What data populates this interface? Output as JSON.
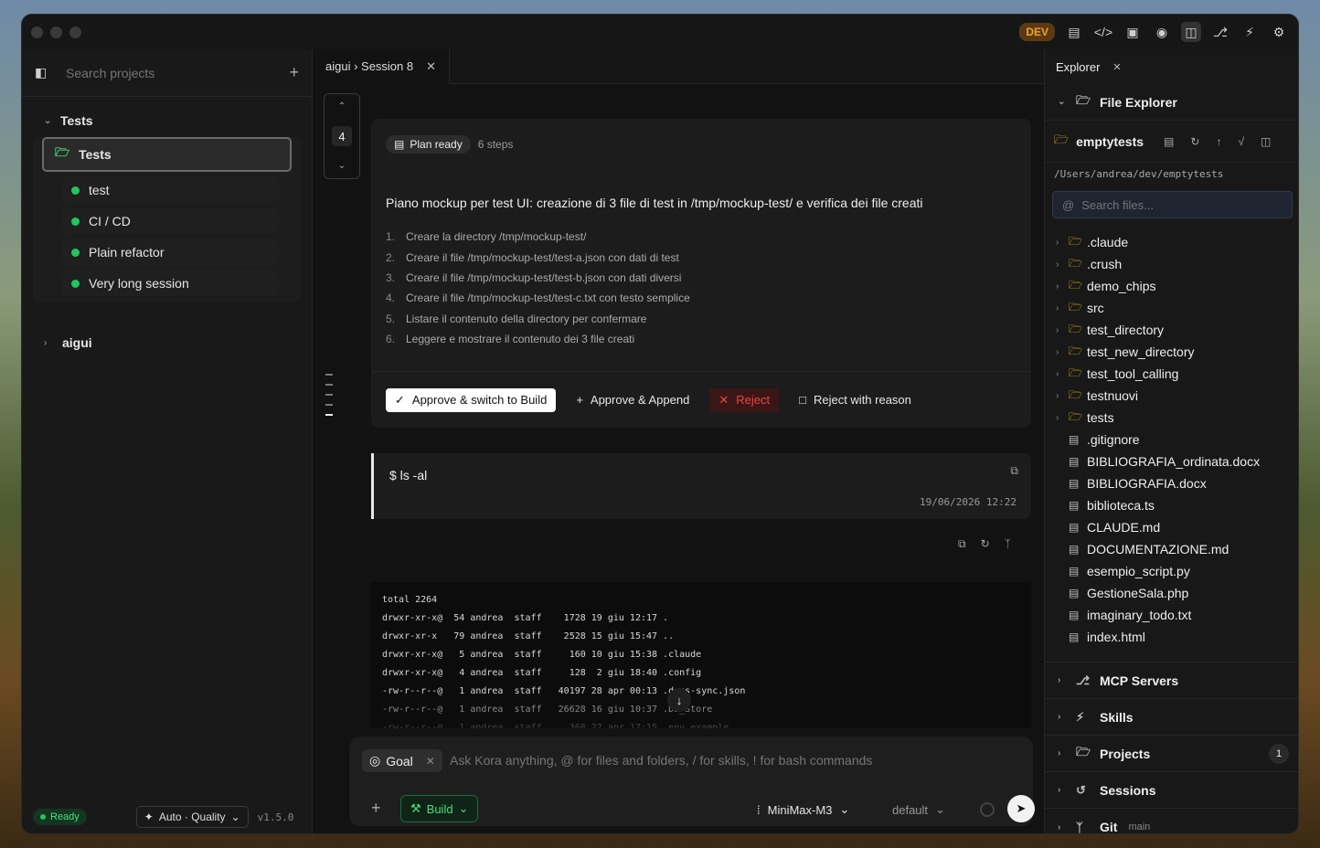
{
  "titlebar": {
    "dev_badge": "DEV",
    "icons": [
      "file-tree-icon",
      "code-icon",
      "terminal-icon",
      "palette-icon",
      "panel-icon",
      "plug-icon",
      "bolt-icon",
      "settings-icon"
    ]
  },
  "sidebar": {
    "search_placeholder": "Search projects",
    "groups": [
      {
        "name": "Tests",
        "folder": "Tests",
        "sessions": [
          "test",
          "CI / CD",
          "Plain refactor",
          "Very long session"
        ]
      },
      {
        "name": "aigui"
      }
    ],
    "status": "Ready",
    "mode": "Auto · Quality",
    "version": "v1.5.0"
  },
  "center": {
    "tab": {
      "label": "aigui › Session 8"
    },
    "stepper": {
      "value": "4"
    },
    "plan": {
      "badge": "Plan ready",
      "steps": "6 steps",
      "title": "Piano mockup per test UI: creazione di 3 file di test in /tmp/mockup-test/ e verifica dei file creati",
      "items": [
        "Creare la directory /tmp/mockup-test/",
        "Creare il file /tmp/mockup-test/test-a.json con dati di test",
        "Creare il file /tmp/mockup-test/test-b.json con dati diversi",
        "Creare il file /tmp/mockup-test/test-c.txt con testo semplice",
        "Listare il contenuto della directory per confermare",
        "Leggere e mostrare il contenuto dei 3 file creati"
      ],
      "actions": {
        "approve_build": "Approve & switch to Build",
        "approve_append": "Approve & Append",
        "reject": "Reject",
        "reject_reason": "Reject with reason"
      }
    },
    "command": {
      "text": "$ ls -al",
      "time": "19/06/2026 12:22"
    },
    "terminal": [
      "total 2264",
      "drwxr-xr-x@  54 andrea  staff    1728 19 giu 12:17 .",
      "drwxr-xr-x   79 andrea  staff    2528 15 giu 15:47 ..",
      "drwxr-xr-x@   5 andrea  staff     160 10 giu 15:38 .claude",
      "drwxr-xr-x@   4 andrea  staff     128  2 giu 18:40 .config",
      "-rw-r--r--@   1 andrea  staff   40197 28 apr 00:13 .docs-sync.json",
      "-rw-r--r--@   1 andrea  staff   26628 16 giu 10:37 .DS_Store",
      "-rw-r--r--@   1 andrea  staff     368 27 apr 17:15 .env.example"
    ],
    "composer": {
      "goal_label": "Goal",
      "placeholder": "Ask Kora anything, @ for files and folders, / for skills, ! for bash commands",
      "build_label": "Build",
      "model": "MiniMax-M3",
      "variant": "default"
    }
  },
  "right": {
    "tab": "Explorer",
    "file_explorer": "File Explorer",
    "project": "emptytests",
    "path": "/Users/andrea/dev/emptytests",
    "search_placeholder": "Search files...",
    "folders": [
      ".claude",
      ".crush",
      "demo_chips",
      "src",
      "test_directory",
      "test_new_directory",
      "test_tool_calling",
      "testnuovi",
      "tests"
    ],
    "files": [
      ".gitignore",
      "BIBLIOGRAFIA_ordinata.docx",
      "BIBLIOGRAFIA.docx",
      "biblioteca.ts",
      "CLAUDE.md",
      "DOCUMENTAZIONE.md",
      "esempio_script.py",
      "GestioneSala.php",
      "imaginary_todo.txt",
      "index.html"
    ],
    "sections": {
      "mcp": "MCP Servers",
      "skills": "Skills",
      "projects": "Projects",
      "projects_count": "1",
      "sessions": "Sessions",
      "git": "Git",
      "git_branch": "main"
    }
  }
}
